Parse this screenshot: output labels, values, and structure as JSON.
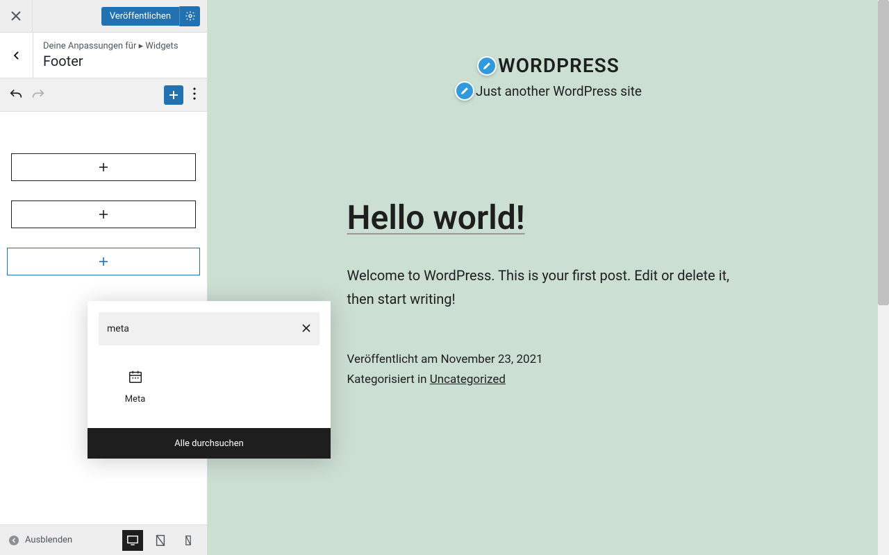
{
  "topbar": {
    "publish_label": "Veröffentlichen"
  },
  "crumb": {
    "path": "Deine Anpassungen für ▸ Widgets",
    "title": "Footer"
  },
  "popup": {
    "search_value": "meta",
    "item_label": "Meta",
    "browse_label": "Alle durchsuchen"
  },
  "footerbar": {
    "collapse_label": "Ausblenden"
  },
  "preview": {
    "site_title": "WORDPRESS",
    "site_tagline": "Just another WordPress site",
    "post_title": "Hello world!",
    "post_body": "Welcome to WordPress. This is your first post. Edit or delete it, then start writing!",
    "published_label": "Veröffentlicht am ",
    "published_date": "November 23, 2021",
    "categorized_label": "Kategorisiert in ",
    "category": "Uncategorized"
  }
}
